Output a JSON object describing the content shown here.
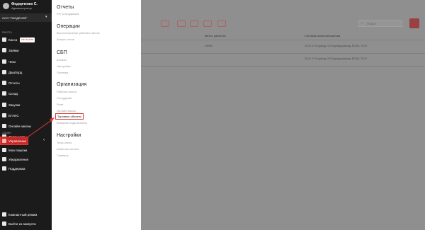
{
  "sidebar": {
    "user_name": "Федорченко С.",
    "user_role": "Администратор",
    "org_name": "ООО \"ГЛЮДЕНЕЙ\"",
    "section_work": "РАБОТА",
    "section_admin": "АДМИН",
    "items": [
      {
        "label": "Касса",
        "icon": "cash-register-icon"
      },
      {
        "label": "Заявки",
        "icon": "orders-icon"
      },
      {
        "label": "Чеки",
        "icon": "receipt-icon"
      },
      {
        "label": "Дашборд",
        "icon": "dashboard-icon"
      },
      {
        "label": "Отчеты",
        "icon": "report-icon"
      },
      {
        "label": "Склад",
        "icon": "warehouse-icon"
      },
      {
        "label": "Закупки",
        "icon": "cart-icon"
      },
      {
        "label": "ЕГАИС",
        "icon": "egais-icon"
      },
      {
        "label": "Онлайн-заказы",
        "icon": "online-orders-icon"
      },
      {
        "label": "Лояльность",
        "icon": "loyalty-icon"
      }
    ],
    "kassa_badge": "Нет в сети",
    "admin_items": [
      {
        "label": "Управление",
        "icon": "settings-icon"
      },
      {
        "label": "Мои покупки",
        "icon": "bag-icon"
      },
      {
        "label": "Уведомления",
        "icon": "bell-icon"
      },
      {
        "label": "Поддержка",
        "icon": "support-icon"
      }
    ],
    "bottom_items": [
      {
        "label": "Компактный режим",
        "icon": "compact-mode-icon"
      },
      {
        "label": "Выйти из аккаунта",
        "icon": "logout-icon"
      }
    ]
  },
  "panel": {
    "groups": [
      {
        "title": "Отчеты",
        "items": [
          "KPI Сотрудников"
        ]
      },
      {
        "title": "Операции",
        "items": [
          "Восстановление рабочего места",
          "Запрос логов"
        ]
      },
      {
        "title": "СБП",
        "items": [
          "Шлюзы",
          "Настройки",
          "Платежи"
        ]
      },
      {
        "title": "Организация",
        "items": [
          "Рабочие места",
          "Сотрудники",
          "Роли",
          "Онлайн-Кассы",
          "Торговые объекты",
          "Внешние подключения"
        ]
      },
      {
        "title": "Настройки",
        "items": [
          "Типы оплат",
          "Шаблоны печати",
          "Сканеры"
        ]
      }
    ],
    "selected_item": "Торговые объекты"
  },
  "main": {
    "search_placeholder": "Поиск",
    "columns": [
      "Место расчетов",
      "Система налогообложения"
    ],
    "rows": [
      {
        "place": "ОФИС",
        "tax": "ОСН, УСН доход, УСН доход-расход, ЕСХН, ПСН"
      },
      {
        "place": "",
        "tax": "ОСН, УСН доход, УСН доход-расход, ЕСХН, ПСН"
      }
    ]
  },
  "colors": {
    "accent": "#e53935",
    "sidebar": "#1b1b1b",
    "overlay": "#8f8f8f"
  }
}
